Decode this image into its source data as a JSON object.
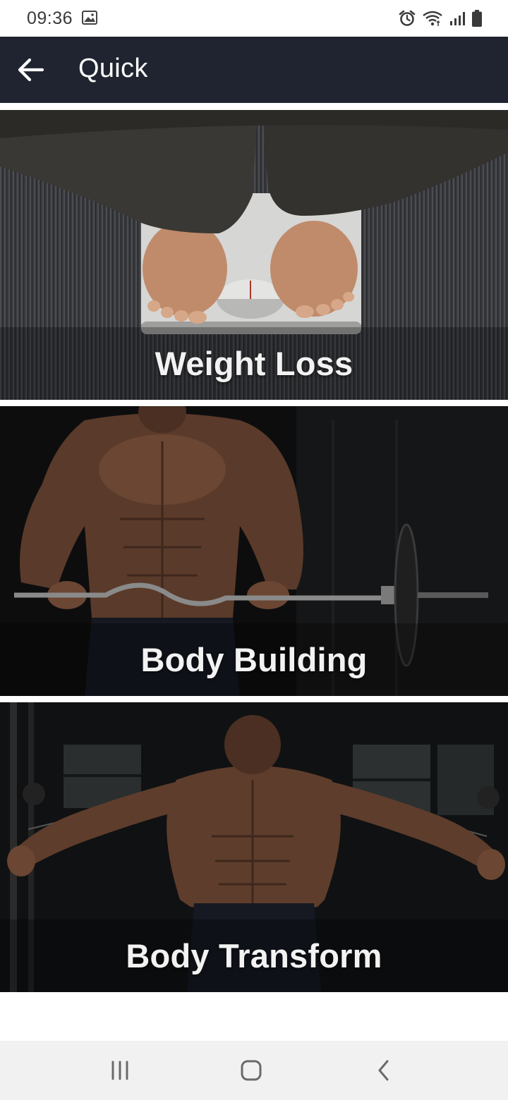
{
  "status_bar": {
    "time": "09:36",
    "icons": [
      "image-icon",
      "alarm-icon",
      "wifi-icon",
      "signal-icon",
      "battery-icon"
    ]
  },
  "app_bar": {
    "title": "Quick",
    "back_icon": "arrow-left-icon",
    "background": "#1f2430"
  },
  "categories": [
    {
      "label": "Weight Loss",
      "image": "feet-on-scale-photo"
    },
    {
      "label": "Body Building",
      "image": "barbell-curl-photo"
    },
    {
      "label": "Body Transform",
      "image": "cable-fly-photo"
    }
  ],
  "nav_bar": {
    "buttons": [
      "recents-icon",
      "home-icon",
      "back-chevron-icon"
    ]
  }
}
